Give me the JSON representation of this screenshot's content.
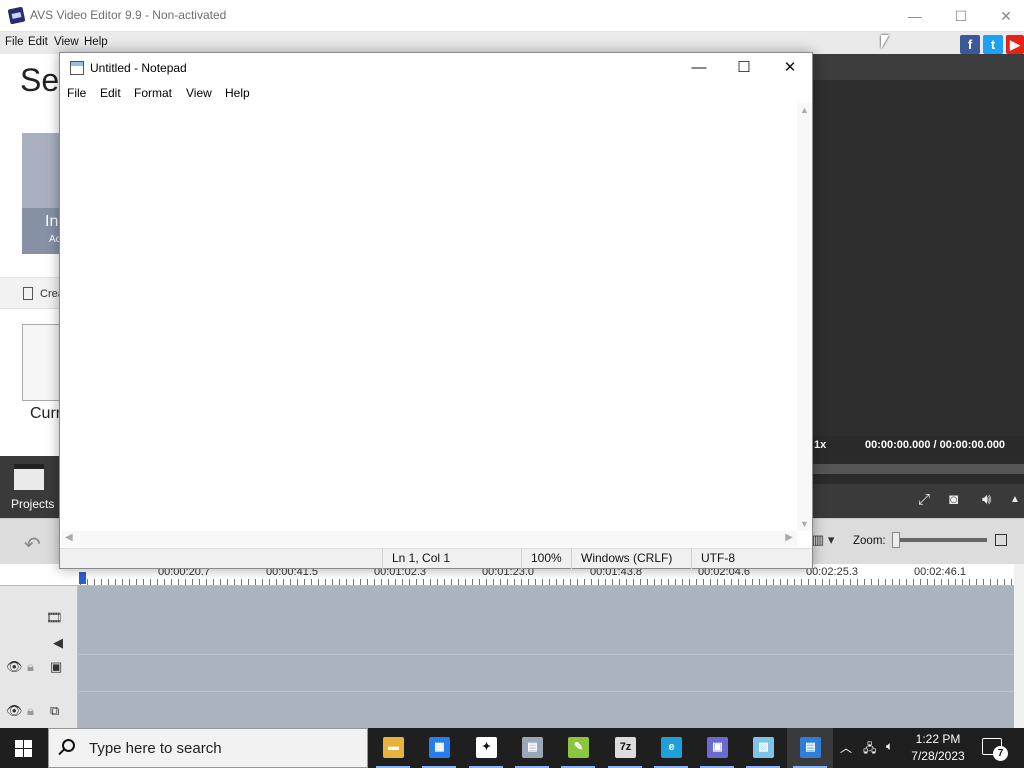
{
  "avs": {
    "title": "AVS Video Editor 9.9 - Non-activated",
    "menu": [
      "File",
      "Edit",
      "View",
      "Help"
    ],
    "big_title": "Sel",
    "import_tile_line1": "In",
    "import_tile_line2": "Ac",
    "create_label": "Crea",
    "current_label": "Curr",
    "projects_label": "Projects",
    "speed": "1x",
    "timecode": "00:00:00.000 / 00:00:00.000",
    "zoom_label": "Zoom:",
    "zoom_level": 0.0,
    "ruler_times": [
      "00:00:20.7",
      "00:00:41.5",
      "00:01:02.3",
      "00:01:23.0",
      "00:01:43.8",
      "00:02:04.6",
      "00:02:25.3",
      "00:02:46.1"
    ]
  },
  "notepad": {
    "title": "Untitled - Notepad",
    "menu": [
      "File",
      "Edit",
      "Format",
      "View",
      "Help"
    ],
    "content": "",
    "status": {
      "position": "Ln 1, Col 1",
      "zoom": "100%",
      "line_ending": "Windows (CRLF)",
      "encoding": "UTF-8"
    }
  },
  "taskbar": {
    "search_placeholder": "Type here to search",
    "apps": [
      {
        "name": "file-explorer",
        "glyph": "▬",
        "color": "#e8b33a"
      },
      {
        "name": "microsoft-store",
        "glyph": "▦",
        "color": "#2b7de9"
      },
      {
        "name": "game-app",
        "glyph": "✦",
        "color": "#ffffff"
      },
      {
        "name": "network-app",
        "glyph": "▤",
        "color": "#9aa7b8"
      },
      {
        "name": "notepad-plus-plus",
        "glyph": "✎",
        "color": "#8cc63f"
      },
      {
        "name": "seven-zip",
        "glyph": "7z",
        "color": "#dddddd"
      },
      {
        "name": "edge",
        "glyph": "e",
        "color": "#1fa0d8"
      },
      {
        "name": "avs-video-editor",
        "glyph": "▣",
        "color": "#6a6ad0"
      },
      {
        "name": "wordpad",
        "glyph": "▧",
        "color": "#7fc3e8"
      },
      {
        "name": "notepad",
        "glyph": "▤",
        "color": "#2f7fd8"
      }
    ],
    "clock_time": "1:22 PM",
    "clock_date": "7/28/2023",
    "notification_count": "7"
  }
}
